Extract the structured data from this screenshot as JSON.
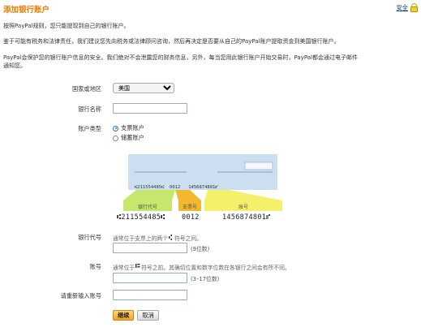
{
  "header": {
    "title": "添加银行账户",
    "security_link": "安全"
  },
  "intro": {
    "line1": "按照PayPal规则，您只能提现到自己的银行账户。",
    "line2": "鉴于可能有税务和法律责任，我们建议您先向税务或法律顾问咨询，然后再决定是否要从自己的PayPal账户提取资金到美国银行账户。",
    "line3a": "PayPal会保护您的银行账户信息的安全。我们绝对不会泄露您的财务信息，另外，每当您用此银行账户开始交易时，PayPal都会通过电子邮件",
    "line3b": "通知您。"
  },
  "form": {
    "country_label": "国家或地区",
    "country_value": "美国",
    "bank_name_label": "银行名称",
    "bank_name_value": "",
    "account_type_label": "账户类型",
    "account_types": [
      {
        "label": "支票账户",
        "selected": true
      },
      {
        "label": "储蓄账户",
        "selected": false
      }
    ],
    "routing_label": "银行代号",
    "routing_help_prefix": "通常位于支票上的两个",
    "routing_help_suffix": "符号之间。",
    "routing_hint": "(9位数)",
    "account_label": "账号",
    "account_help_prefix": "通常位于",
    "account_help_suffix": "符号之前。其确切位置和数字位数在各银行之间会有所不同。",
    "account_hint": "(3–17位数)",
    "reenter_label": "请重新输入账号"
  },
  "check_illustration": {
    "micr_on_check": "⑆211554485⑆  0012   1456874801⑈",
    "routing_tag": "银行代号",
    "check_number_tag": "支票号",
    "account_tag": "账号",
    "routing_number": "⑆211554485⑆",
    "check_number": "0012",
    "account_number": "1456874801⑈"
  },
  "buttons": {
    "continue": "继续",
    "cancel": "取消"
  },
  "colors": {
    "title_orange": "#e87d00",
    "link_blue": "#084482",
    "tag_green": "#c5e86c",
    "tag_orange": "#f2b92f",
    "tag_yellow": "#f4f06a"
  }
}
